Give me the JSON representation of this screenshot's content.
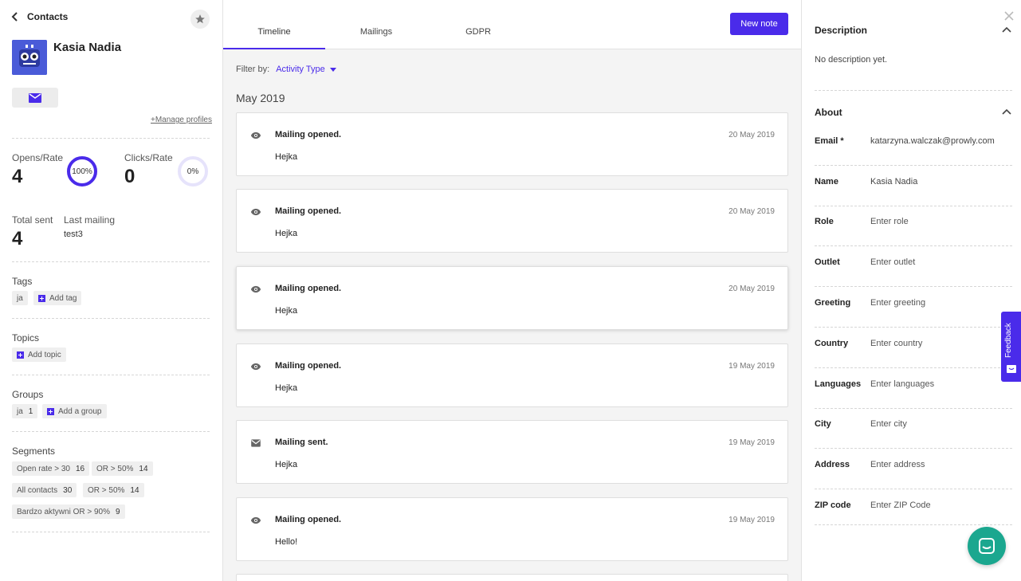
{
  "sidebar": {
    "back_label": "Contacts",
    "contact_name": "Kasia Nadia",
    "manage_profiles": "+Manage profiles",
    "opens_label": "Opens/Rate",
    "opens_value": "4",
    "opens_rate": "100%",
    "opens_rate_fraction": 1.0,
    "clicks_label": "Clicks/Rate",
    "clicks_value": "0",
    "clicks_rate": "0%",
    "clicks_rate_fraction": 0.0,
    "total_sent_label": "Total sent",
    "total_sent_value": "4",
    "last_mailing_label": "Last mailing",
    "last_mailing_value": "test3",
    "tags_title": "Tags",
    "tags": [
      "ja"
    ],
    "add_tag": "Add tag",
    "topics_title": "Topics",
    "add_topic": "Add topic",
    "groups_title": "Groups",
    "groups": [
      {
        "name": "ja",
        "count": "1"
      }
    ],
    "add_group": "Add a group",
    "segments_title": "Segments",
    "segments": [
      {
        "name": "Open rate > 30",
        "count": "16"
      },
      {
        "name": "OR > 50%",
        "count": "14"
      },
      {
        "name": "All contacts",
        "count": "30"
      },
      {
        "name": "OR > 50%",
        "count": "14"
      },
      {
        "name": "Bardzo aktywni OR > 90%",
        "count": "9"
      }
    ]
  },
  "main": {
    "tabs": [
      "Timeline",
      "Mailings",
      "GDPR"
    ],
    "active_tab": "Timeline",
    "new_note": "New note",
    "filter_label": "Filter by:",
    "filter_value": "Activity Type",
    "month": "May 2019",
    "events": [
      {
        "icon": "eye-icon",
        "title": "Mailing opened.",
        "date": "20 May 2019",
        "body": "Hejka"
      },
      {
        "icon": "eye-icon",
        "title": "Mailing opened.",
        "date": "20 May 2019",
        "body": "Hejka"
      },
      {
        "icon": "eye-icon",
        "title": "Mailing opened.",
        "date": "20 May 2019",
        "body": "Hejka"
      },
      {
        "icon": "eye-icon",
        "title": "Mailing opened.",
        "date": "19 May 2019",
        "body": "Hejka"
      },
      {
        "icon": "envelope-icon",
        "title": "Mailing sent.",
        "date": "19 May 2019",
        "body": "Hejka"
      },
      {
        "icon": "eye-icon",
        "title": "Mailing opened.",
        "date": "19 May 2019",
        "body": "Hello!"
      }
    ]
  },
  "details": {
    "description_title": "Description",
    "description_text": "No description yet.",
    "about_title": "About",
    "fields": [
      {
        "key": "Email *",
        "value": "katarzyna.walczak@prowly.com"
      },
      {
        "key": "Name",
        "value": "Kasia Nadia"
      },
      {
        "key": "Role",
        "value": "Enter role"
      },
      {
        "key": "Outlet",
        "value": "Enter outlet"
      },
      {
        "key": "Greeting",
        "value": "Enter greeting"
      },
      {
        "key": "Country",
        "value": "Enter country"
      },
      {
        "key": "Languages",
        "value": "Enter languages"
      },
      {
        "key": "City",
        "value": "Enter city"
      },
      {
        "key": "Address",
        "value": "Enter address"
      },
      {
        "key": "ZIP code",
        "value": "Enter ZIP Code"
      }
    ]
  },
  "feedback_label": "Feedback",
  "colors": {
    "accent": "#4a2bea",
    "chat": "#1ba78f"
  }
}
